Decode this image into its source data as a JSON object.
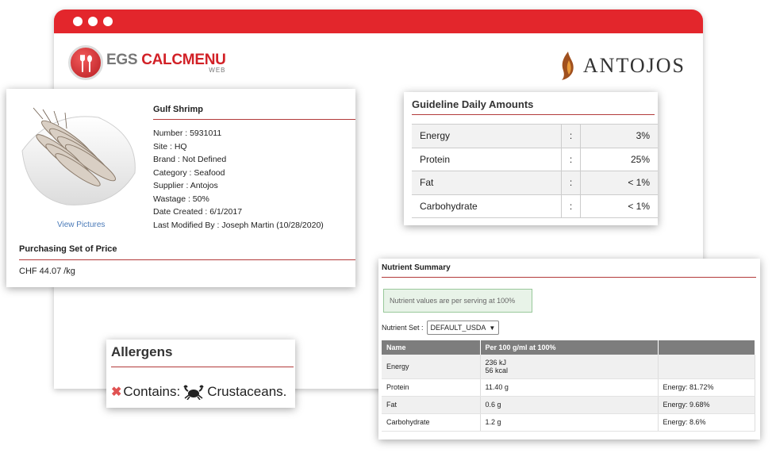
{
  "brand": {
    "left_logo": {
      "part1": "EGS ",
      "part2": "CALCMENU",
      "sub": "WEB"
    },
    "right_logo": {
      "wordmark": "ANTOJOS"
    },
    "colors": {
      "accent": "#e3262c",
      "rule": "#b23a3a",
      "link": "#4a7ab8"
    }
  },
  "product": {
    "title": "Gulf Shrimp",
    "image_icon": "shrimp-photo",
    "view_pictures": "View Pictures",
    "details": [
      "Number : 5931011",
      "Site : HQ",
      "Brand : Not Defined",
      "Category : Seafood",
      "Supplier : Antojos",
      "Wastage : 50%",
      "Date Created : 6/1/2017",
      "Last Modified By : Joseph Martin (10/28/2020)"
    ],
    "purchasing_label": "Purchasing Set of Price",
    "purchasing_price": "CHF 44.07 /kg"
  },
  "guideline": {
    "title": "Guideline Daily Amounts",
    "rows": [
      {
        "name": "Energy",
        "sep": ":",
        "value": "3%"
      },
      {
        "name": "Protein",
        "sep": ":",
        "value": "25%"
      },
      {
        "name": "Fat",
        "sep": ":",
        "value": "< 1%"
      },
      {
        "name": "Carbohydrate",
        "sep": ":",
        "value": "< 1%"
      }
    ]
  },
  "nutrient_summary": {
    "title": "Nutrient Summary",
    "note": "Nutrient values are per serving at 100%",
    "set_label": "Nutrient Set :",
    "set_value": "DEFAULT_USDA",
    "headers": [
      "Name",
      "Per 100 g/ml at 100%",
      ""
    ],
    "rows": [
      {
        "name": "Energy",
        "per100": [
          "236 kJ",
          "56 kcal"
        ],
        "extra": ""
      },
      {
        "name": "Protein",
        "per100": [
          "11.40 g"
        ],
        "extra": "Energy: 81.72%"
      },
      {
        "name": "Fat",
        "per100": [
          "0.6 g"
        ],
        "extra": "Energy: 9.68%"
      },
      {
        "name": "Carbohydrate",
        "per100": [
          "1.2 g"
        ],
        "extra": "Energy: 8.6%"
      }
    ]
  },
  "allergens": {
    "title": "Allergens",
    "contains_label": "Contains:",
    "icon": "crab-icon",
    "item": "Crustaceans."
  }
}
